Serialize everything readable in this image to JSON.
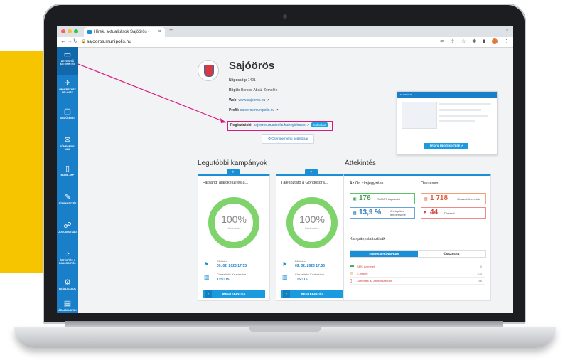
{
  "browser": {
    "tab_title": "Hírek, aktualitások Sajöörös - ...",
    "tab_close": "×",
    "new_tab": "+",
    "url": "sajooros.munipolis.hu"
  },
  "sidebar": {
    "items": [
      {
        "label": "BEVEZETŐ ÁTTEKINTÉS",
        "icon": "dashboard-icon"
      },
      {
        "label": "ÜNNEPEKHEZ FELHASZ",
        "icon": "rocket-icon"
      },
      {
        "label": "SMS ÜZENET",
        "icon": "sms-icon"
      },
      {
        "label": "TÖMEGES E-MAIL",
        "icon": "mail-icon"
      },
      {
        "label": "MOBIL APP",
        "icon": "mobile-icon"
      },
      {
        "label": "SZERKESZTÉS",
        "icon": "edit-icon"
      },
      {
        "label": "JOGOSULTSÁG",
        "icon": "user-group-icon"
      },
      {
        "label": "ÉRTESÍTÉS A LAKOSOKTÓL",
        "icon": "chat-icon"
      },
      {
        "label": "BEÁLLÍTÁSOK",
        "icon": "gear-icon"
      },
      {
        "label": "ÁRAJÁNLATOK",
        "icon": "pricing-icon"
      }
    ]
  },
  "profile": {
    "city": "Sajóörös",
    "population_label": "Népesség:",
    "population": "1491",
    "region_label": "Régió:",
    "region": "Borsod-Abaúj-Zemplén",
    "web_label": "Web:",
    "web": "www.sajooros.hu",
    "profile_label": "Profil:",
    "profile": "sajooros.munipolis.hu",
    "reg_label": "Regisztráció:",
    "reg": "sajooros.munipolis.hu/registracio",
    "copy_button": "Másolás",
    "menu_settings": "Csempe menü beállításai",
    "preview_button": "PROFIL MEGTEKINTÉSE"
  },
  "campaigns": {
    "heading": "Legutóbbi kampányok",
    "items": [
      {
        "name": "Farsangi álarckészítés a...",
        "pct": "100%",
        "pct_label": "Kézbesítve",
        "sent_label": "Elküldve",
        "sent": "09. 02. 2023 17:53",
        "count_label": "Címzettek / Kézbesítve",
        "count": "115/115",
        "button": "MEGTEKINTÉS"
      },
      {
        "name": "Tájékoztató a Gondosóra...",
        "pct": "100%",
        "pct_label": "Kézbesítve",
        "sent_label": "Elküldve",
        "sent": "09. 02. 2023 17:50",
        "count_label": "Címzettek / Kézbesítve",
        "count": "115/115",
        "button": "MEGTEKINTÉS"
      }
    ]
  },
  "overview": {
    "heading": "Áttekintés",
    "contacts_title": "Az Ön címjegyzéke",
    "total_title": "Összesen",
    "smart_value": "176",
    "smart_label": "SMART kapcsolat",
    "settlement_value": "13,9 %",
    "settlement_label": "A település lefedettsége",
    "read_value": "1 718",
    "read_label": "Olvasott üzenetek",
    "likes_value": "44",
    "likes_label": "Dicséret",
    "stats_title": "Kampánystatisztikák",
    "tab_month": "EBBEN A HÓNAPBAN",
    "tab_total": "ÖSSZESEN",
    "rows": [
      {
        "label": "SMS üzenetek",
        "value": "0"
      },
      {
        "label": "E-mailek",
        "value": "100"
      },
      {
        "label": "Üzenetek az alkalmazásban",
        "value": "86"
      }
    ]
  },
  "colors": {
    "accent": "#1a8fd6",
    "ring": "#7ed36a",
    "highlight": "#d81b7f",
    "yellow": "#f7c400"
  }
}
